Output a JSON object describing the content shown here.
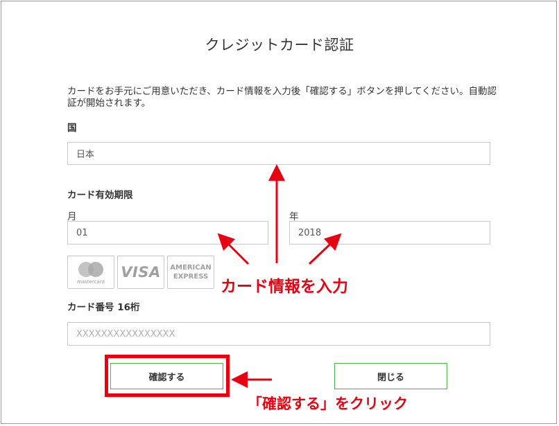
{
  "title": "クレジットカード認証",
  "intro_text": "カードをお手元にご用意いただき、カード情報を入力後「確認する」ボタンを押してください。自動認証が開始されます。",
  "country": {
    "label": "国",
    "value": "日本"
  },
  "expiry": {
    "label": "カード有効期限",
    "month_label": "月",
    "month_value": "01",
    "year_label": "年",
    "year_value": "2018"
  },
  "card_logos": {
    "mastercard": "mastercard",
    "visa": "VISA",
    "amex_line1": "AMERICAN",
    "amex_line2": "EXPRESS"
  },
  "card_number": {
    "label": "カード番号 16桁",
    "placeholder": "XXXXXXXXXXXXXXXX"
  },
  "buttons": {
    "confirm": "確認する",
    "close": "閉じる"
  },
  "annotations": {
    "enter_card_info": "カード情報を入力",
    "click_confirm": "「確認する」をクリック"
  },
  "colors": {
    "annotation_red": "#e60012",
    "button_border_green": "#4bb04b"
  }
}
